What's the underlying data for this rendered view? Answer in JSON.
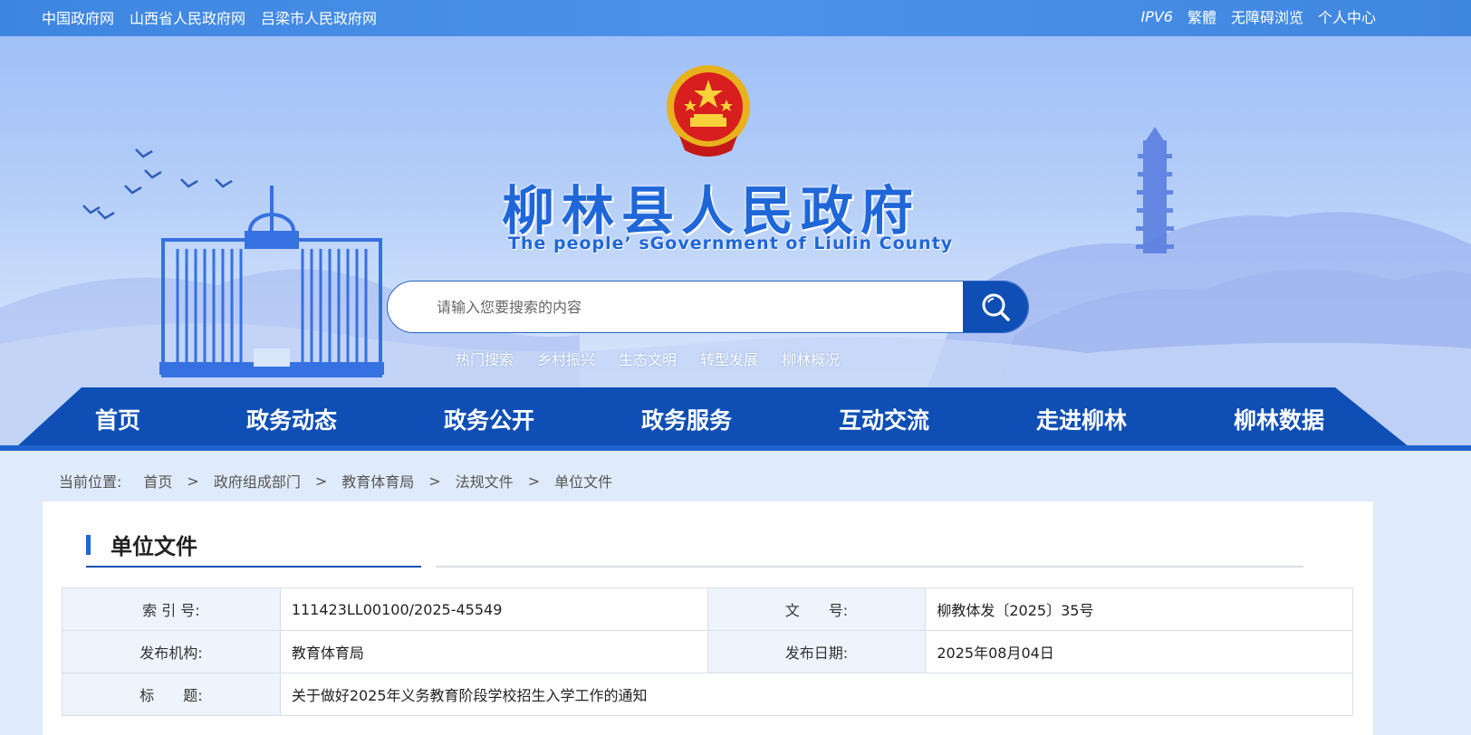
{
  "topbar": {
    "left_links": [
      "中国政府网",
      "山西省人民政府网",
      "吕梁市人民政府网"
    ],
    "ipv6": "IPV6",
    "right_links": [
      "繁體",
      "无障碍浏览",
      "个人中心"
    ]
  },
  "banner": {
    "title": "柳林县人民政府",
    "subtitle": "The people’ sGovernment of Liulin County",
    "emblem_icon": "national-emblem-icon"
  },
  "search": {
    "placeholder": "请输入您要搜索的内容",
    "hot_label": "热门搜索",
    "hot_terms": [
      "乡村振兴",
      "生态文明",
      "转型发展",
      "柳林概况"
    ]
  },
  "nav": {
    "items": [
      "首页",
      "政务动态",
      "政务公开",
      "政务服务",
      "互动交流",
      "走进柳林",
      "柳林数据"
    ]
  },
  "breadcrumb": {
    "label": "当前位置:",
    "items": [
      "首页",
      "政府组成部门",
      "教育体育局",
      "法规文件",
      "单位文件"
    ],
    "separator": ">"
  },
  "panel": {
    "title": "单位文件",
    "meta": {
      "index_label": "索 引 号:",
      "index_value": "111423LL00100/2025-45549",
      "docno_label": "文　　号:",
      "docno_value": "柳教体发〔2025〕35号",
      "org_label": "发布机构:",
      "org_value": "教育体育局",
      "date_label": "发布日期:",
      "date_value": "2025年08月04日",
      "title_label": "标　　题:",
      "title_value": "关于做好2025年义务教育阶段学校招生入学工作的通知"
    }
  },
  "colors": {
    "primary_blue": "#0f4fb5",
    "accent_blue": "#1f66d8",
    "topbar_blue": "#4d92ea"
  }
}
